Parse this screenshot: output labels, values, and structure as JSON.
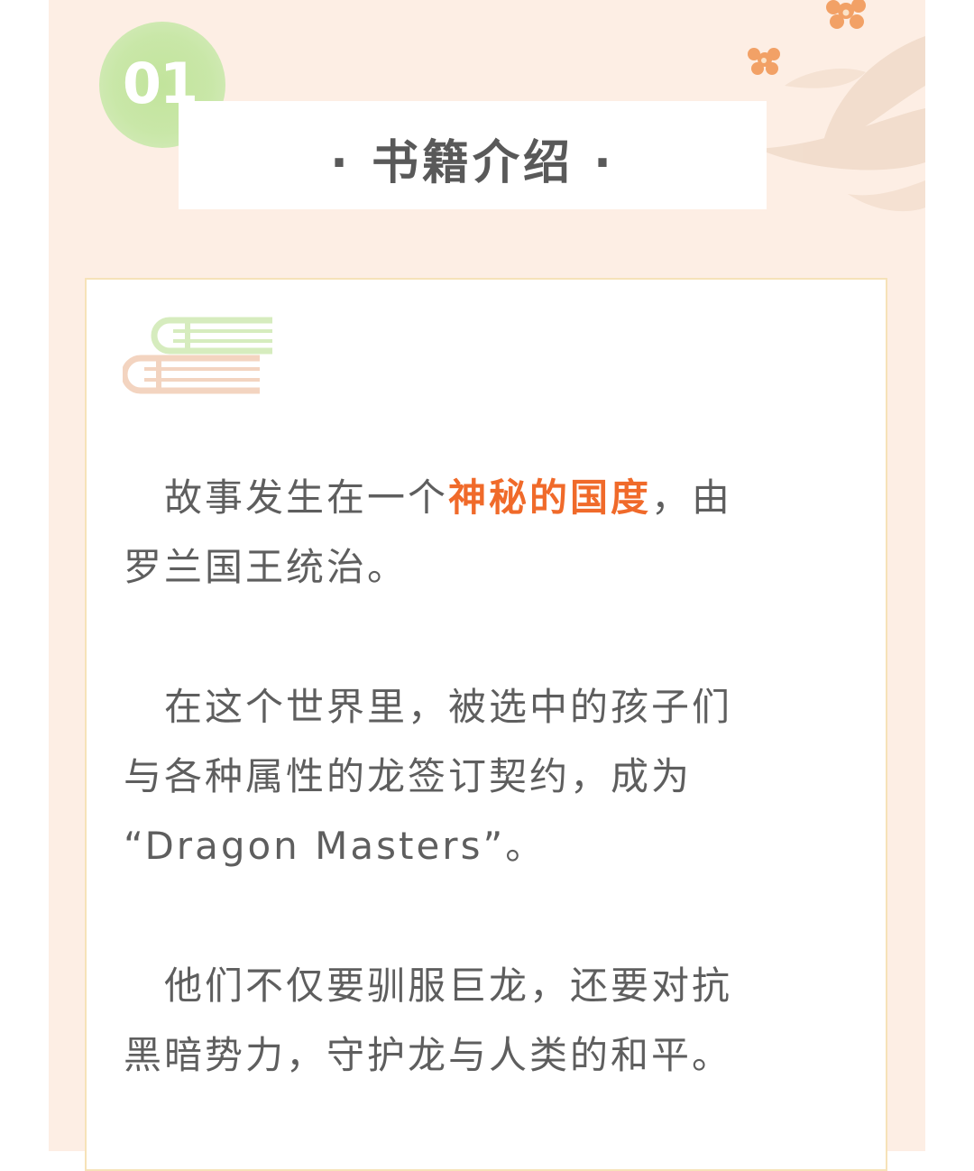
{
  "header": {
    "number": "01",
    "title": "· 书籍介绍 ·"
  },
  "colors": {
    "page_background": "#fdeee4",
    "badge": "#c9e7a8",
    "title_text": "#595959",
    "body_text": "#5e5e5e",
    "highlight": "#f06a2a",
    "card_border": "#f6e2b8",
    "book_top": "#d6ecbe",
    "book_bottom": "#f3d4c0",
    "flower": "#f2a166",
    "leaf": "#f1dccb"
  },
  "icons": [
    "book-stack-icon",
    "flower-leaf-decoration"
  ],
  "paragraphs": [
    {
      "line1_before": "　故事发生在一个",
      "line1_highlight": "神秘的国度",
      "line1_after": "，由",
      "line2": "罗兰国王统治。"
    },
    {
      "line1": "　在这个世界里，被选中的孩子们",
      "line2": "与各种属性的龙签订契约，成为",
      "line3": "“Dragon Masters”。"
    },
    {
      "line1": "　他们不仅要驯服巨龙，还要对抗",
      "line2": "黑暗势力，守护龙与人类的和平。"
    }
  ]
}
